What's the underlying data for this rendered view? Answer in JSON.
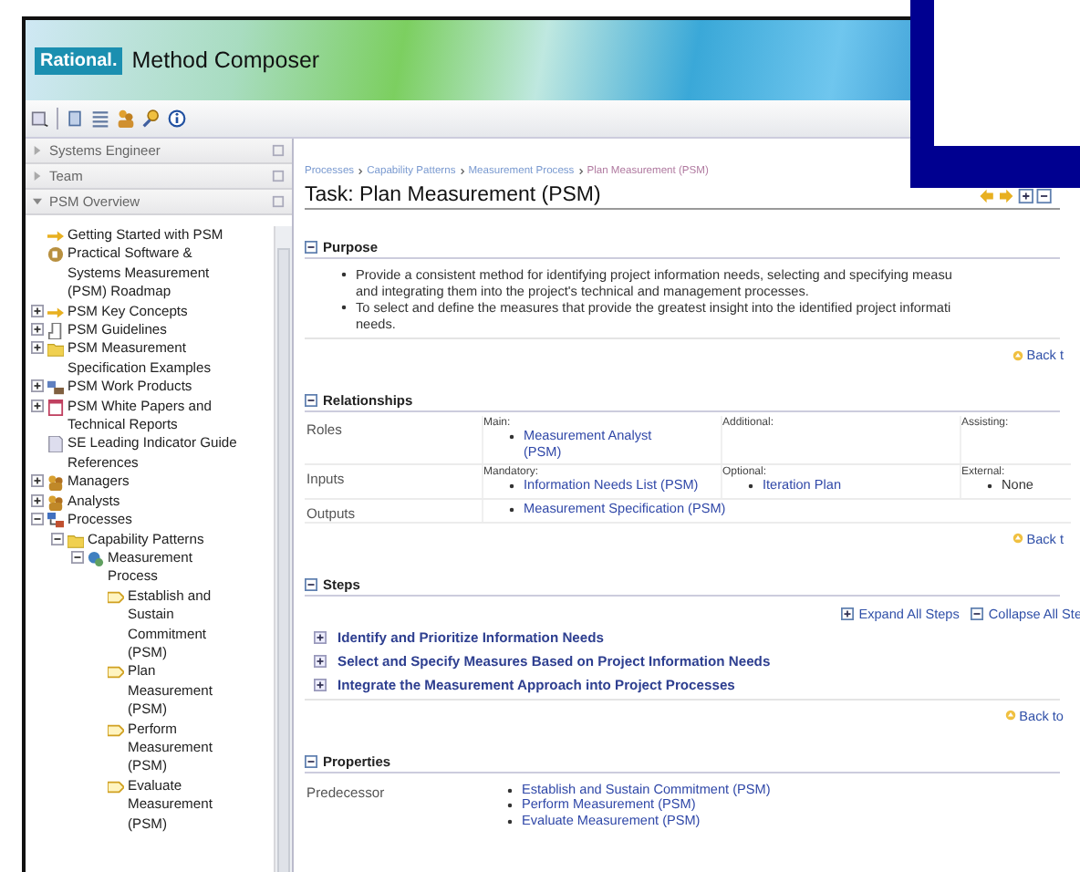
{
  "banner": {
    "brand": "Rational.",
    "product": "Method Composer"
  },
  "left_panel": {
    "headers": [
      {
        "label": "Systems Engineer",
        "expanded": false
      },
      {
        "label": "Team",
        "expanded": false
      },
      {
        "label": "PSM Overview",
        "expanded": true
      }
    ],
    "tree": [
      {
        "label": "Getting Started with PSM",
        "kind": "arrow"
      },
      {
        "label": "Practical Software & Systems Measurement (PSM) Roadmap",
        "kind": "roadmap"
      },
      {
        "label": "PSM Key Concepts",
        "kind": "arrow",
        "expanded": false
      },
      {
        "label": "PSM Guidelines",
        "kind": "guide",
        "expanded": false
      },
      {
        "label": "PSM Measurement Specification Examples",
        "kind": "folder",
        "expanded": false
      },
      {
        "label": "PSM Work Products",
        "kind": "workproduct",
        "expanded": false
      },
      {
        "label": "PSM White Papers and Technical Reports",
        "kind": "page",
        "expanded": false
      },
      {
        "label": "SE Leading Indicator Guide References",
        "kind": "doc"
      },
      {
        "label": "Managers",
        "kind": "people",
        "expanded": false
      },
      {
        "label": "Analysts",
        "kind": "people",
        "expanded": false
      },
      {
        "label": "Processes",
        "kind": "process",
        "expanded": true,
        "children": [
          {
            "label": "Capability Patterns",
            "kind": "folder",
            "expanded": true,
            "children": [
              {
                "label": "Measurement Process",
                "kind": "pattern",
                "expanded": true,
                "children": [
                  {
                    "label": "Establish and Sustain Commitment (PSM)",
                    "kind": "task"
                  },
                  {
                    "label": "Plan Measurement (PSM)",
                    "kind": "task"
                  },
                  {
                    "label": "Perform Measurement (PSM)",
                    "kind": "task"
                  },
                  {
                    "label": "Evaluate Measurement (PSM)",
                    "kind": "task"
                  }
                ]
              }
            ]
          }
        ]
      }
    ]
  },
  "content": {
    "breadcrumb": [
      {
        "label": "Processes",
        "selected": false
      },
      {
        "label": "Capability Patterns",
        "selected": false
      },
      {
        "label": "Measurement Process",
        "selected": false
      },
      {
        "label": "Plan Measurement (PSM)",
        "selected": true
      }
    ],
    "title": "Task: Plan Measurement (PSM)",
    "purpose": {
      "heading": "Purpose",
      "bullets": [
        {
          "lines": [
            "Provide a consistent method for identifying project information needs, selecting and specifying measu",
            "and integrating them into the project's technical and management processes."
          ]
        },
        {
          "lines": [
            "To select and define the measures that provide the greatest insight into the identified project informati",
            "needs."
          ]
        }
      ],
      "back": "Back t"
    },
    "relationships": {
      "heading": "Relationships",
      "rows": [
        {
          "label": "Roles",
          "cells": [
            {
              "caption": "Main:",
              "kind": "link",
              "items": [
                "Measurement Analyst (PSM)"
              ]
            },
            {
              "caption": "Additional:"
            },
            {
              "caption": "Assisting:"
            }
          ]
        },
        {
          "label": "Inputs",
          "cells": [
            {
              "caption": "Mandatory:",
              "kind": "link",
              "items": [
                "Information Needs List (PSM)"
              ]
            },
            {
              "caption": "Optional:",
              "kind": "link",
              "items": [
                "Iteration Plan"
              ]
            },
            {
              "caption": "External:",
              "kind": "plain",
              "items": [
                "None"
              ]
            }
          ]
        },
        {
          "label": "Outputs",
          "cells": [
            {
              "kind": "link",
              "items": [
                "Measurement Specification (PSM)"
              ]
            }
          ]
        }
      ],
      "back": "Back t"
    },
    "steps": {
      "heading": "Steps",
      "expand_all": "Expand All Steps",
      "collapse_all": "Collapse All Ste",
      "items": [
        {
          "label": "Identify and Prioritize Information Needs",
          "expanded": false
        },
        {
          "label": "Select and Specify Measures Based on Project Information Needs",
          "expanded": false
        },
        {
          "label": "Integrate the Measurement Approach into Project Processes",
          "expanded": false
        }
      ],
      "back": "Back to"
    },
    "properties": {
      "heading": "Properties",
      "rows": [
        {
          "label": "Predecessor",
          "items": [
            "Establish and Sustain Commitment (PSM)",
            "Perform Measurement (PSM)",
            "Evaluate Measurement (PSM)"
          ]
        }
      ]
    }
  }
}
